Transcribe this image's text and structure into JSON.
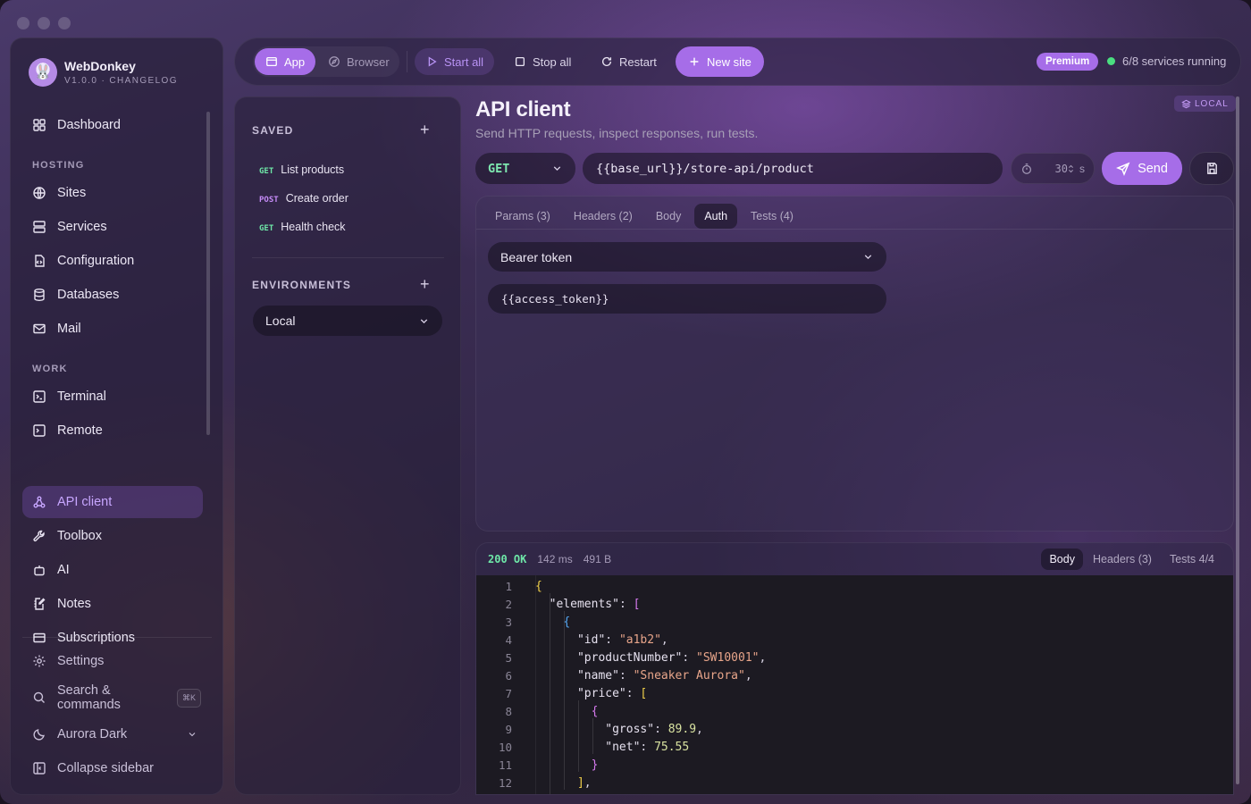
{
  "brand": {
    "name": "WebDonkey",
    "version": "V1.0.0 · CHANGELOG"
  },
  "sidebar": {
    "top": [
      {
        "label": "Dashboard",
        "icon": "grid-icon"
      }
    ],
    "hosting_label": "HOSTING",
    "hosting": [
      {
        "label": "Sites",
        "icon": "globe-icon"
      },
      {
        "label": "Services",
        "icon": "server-icon"
      },
      {
        "label": "Configuration",
        "icon": "file-code-icon"
      },
      {
        "label": "Databases",
        "icon": "database-icon"
      },
      {
        "label": "Mail",
        "icon": "mail-icon"
      }
    ],
    "work_label": "WORK",
    "work": [
      {
        "label": "Terminal",
        "icon": "terminal-icon"
      },
      {
        "label": "Remote",
        "icon": "remote-terminal-icon"
      },
      {
        "label": "API client",
        "icon": "webhook-icon",
        "active": true
      },
      {
        "label": "Toolbox",
        "icon": "wrench-icon"
      },
      {
        "label": "AI",
        "icon": "bot-icon"
      },
      {
        "label": "Notes",
        "icon": "notebook-pen-icon"
      },
      {
        "label": "Subscriptions",
        "icon": "credit-card-icon"
      }
    ],
    "bottom": {
      "settings": "Settings",
      "search": "Search & commands",
      "search_kbd": "⌘K",
      "theme": "Aurora Dark",
      "collapse": "Collapse sidebar"
    }
  },
  "toolbar": {
    "app": "App",
    "browser": "Browser",
    "start_all": "Start all",
    "stop_all": "Stop all",
    "restart": "Restart",
    "new_site": "New site",
    "premium": "Premium",
    "status": "6/8 services running",
    "status_color": "#4ade80"
  },
  "saved": {
    "heading": "SAVED",
    "requests": [
      {
        "method": "GET",
        "name": "List products"
      },
      {
        "method": "POST",
        "name": "Create order"
      },
      {
        "method": "GET",
        "name": "Health check"
      }
    ],
    "env_heading": "ENVIRONMENTS",
    "env_selected": "Local"
  },
  "main": {
    "badge": "LOCAL",
    "title": "API client",
    "subtitle": "Send HTTP requests, inspect responses, run tests.",
    "method": "GET",
    "url": "{{base_url}}/store-api/product",
    "timeout": "30",
    "timeout_unit": "s",
    "send": "Send",
    "tabs": [
      "Params (3)",
      "Headers (2)",
      "Body",
      "Auth",
      "Tests (4)"
    ],
    "active_tab": "Auth",
    "auth_type": "Bearer token",
    "token": "{{access_token}}"
  },
  "response": {
    "code": "200 OK",
    "time": "142 ms",
    "size": "491 B",
    "tabs": [
      "Body",
      "Headers (3)",
      "Tests 4/4"
    ],
    "active_tab": "Body",
    "lines": [
      "{",
      "  \"elements\": [",
      "    {",
      "      \"id\": \"a1b2\",",
      "      \"productNumber\": \"SW10001\",",
      "      \"name\": \"Sneaker Aurora\",",
      "      \"price\": [",
      "        {",
      "          \"gross\": 89.9,",
      "          \"net\": 75.55",
      "        }",
      "      ],"
    ]
  },
  "colors": {
    "accent": "#a66de8",
    "success": "#6ee7a8",
    "post": "#c58bf7"
  }
}
